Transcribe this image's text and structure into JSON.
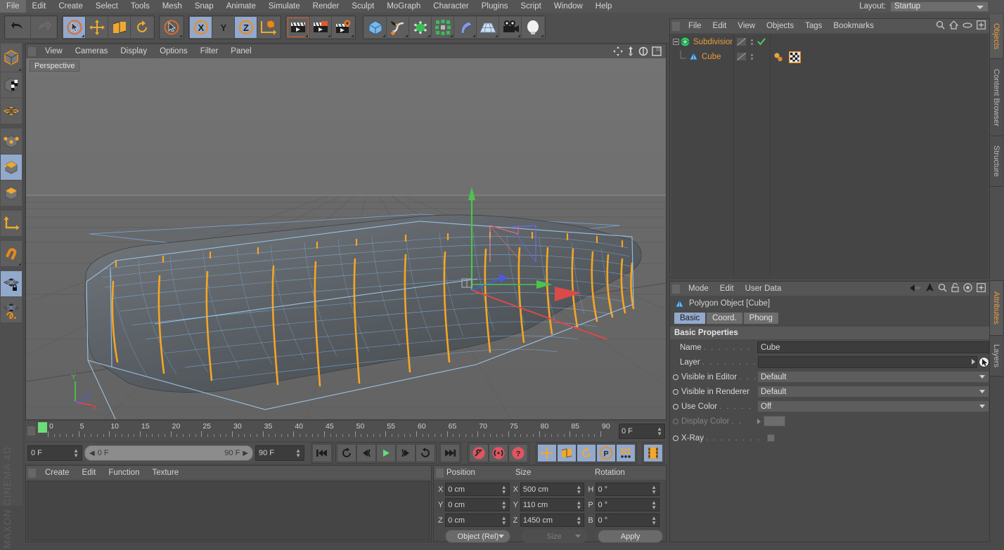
{
  "app": {
    "title": "MAXON CINEMA 4D",
    "brand_line1": "MAXON",
    "brand_line2": "CINEMA 4D"
  },
  "main_menu": [
    "File",
    "Edit",
    "Create",
    "Select",
    "Tools",
    "Mesh",
    "Snap",
    "Animate",
    "Simulate",
    "Render",
    "Sculpt",
    "MoGraph",
    "Character",
    "Plugins",
    "Script",
    "Window",
    "Help"
  ],
  "layout": {
    "label": "Layout:",
    "value": "Startup"
  },
  "toolbar": {
    "undo": "undo-icon",
    "redo": "redo-icon",
    "groups": [
      {
        "items": [
          {
            "icon": "live-selection-icon",
            "selected": true
          },
          {
            "icon": "move-icon",
            "selected": false
          },
          {
            "icon": "scale-icon",
            "selected": false
          },
          {
            "icon": "rotate-icon",
            "selected": false
          }
        ]
      },
      {
        "items": [
          {
            "icon": "selection-tool-icon",
            "selected": false
          }
        ]
      },
      {
        "items": [
          {
            "icon": "axis-x-icon",
            "selected": true
          },
          {
            "icon": "axis-y-icon",
            "selected": false
          },
          {
            "icon": "axis-z-icon",
            "selected": true
          },
          {
            "icon": "world-object-axis-icon",
            "selected": false
          }
        ]
      },
      {
        "items": [
          {
            "icon": "render-view-icon",
            "selected": false
          },
          {
            "icon": "render-region-icon",
            "selected": false
          },
          {
            "icon": "render-settings-icon",
            "selected": false
          }
        ]
      },
      {
        "items": [
          {
            "icon": "cube-primitive-icon",
            "selected": false
          },
          {
            "icon": "spline-pen-icon",
            "selected": false
          },
          {
            "icon": "generator-nurbs-icon",
            "selected": false
          },
          {
            "icon": "mograph-array-icon",
            "selected": false
          },
          {
            "icon": "deformer-bend-icon",
            "selected": false
          },
          {
            "icon": "scene-floor-icon",
            "selected": false
          },
          {
            "icon": "camera-icon",
            "selected": false
          },
          {
            "icon": "light-icon",
            "selected": false
          }
        ]
      }
    ]
  },
  "left_toolbar": [
    {
      "icon": "make-editable-icon",
      "selected": false
    },
    {
      "icon": "texture-axis-icon",
      "selected": false
    },
    {
      "icon": "viewport-solo-icon",
      "selected": false
    },
    {
      "icon": "point-mode-icon",
      "selected": false
    },
    {
      "icon": "edge-mode-icon",
      "selected": true
    },
    {
      "icon": "polygon-mode-icon",
      "selected": false
    },
    {
      "icon": "object-axis-icon",
      "selected": false
    },
    {
      "icon": "enable-snapping-icon",
      "selected": false
    },
    {
      "icon": "lock-workplane-icon",
      "selected": true
    },
    {
      "icon": "workplane-icon",
      "selected": false
    }
  ],
  "viewport": {
    "menu": [
      "View",
      "Cameras",
      "Display",
      "Options",
      "Filter",
      "Panel"
    ],
    "label": "Perspective",
    "corner_icons": [
      "pan-view-icon",
      "dolly-view-icon",
      "rotate-view-icon",
      "maximize-view-icon"
    ],
    "axis_gizmo": {
      "x": "X",
      "y": "Y",
      "z": "Z"
    }
  },
  "timeline": {
    "ticks": [
      0,
      5,
      10,
      15,
      20,
      25,
      30,
      35,
      40,
      45,
      50,
      55,
      60,
      65,
      70,
      75,
      80,
      85,
      90
    ],
    "current_frame": "0 F",
    "min_frame": "0 F",
    "max_frame": "90 F",
    "preview_start": "0 F",
    "preview_end": "90 F"
  },
  "transport": {
    "buttons": [
      {
        "icon": "go-to-start-icon",
        "selected": false
      },
      {
        "icon": "prev-keyframe-icon",
        "selected": false
      },
      {
        "icon": "step-back-icon",
        "selected": false
      },
      {
        "icon": "play-icon",
        "selected": false
      },
      {
        "icon": "step-forward-icon",
        "selected": false
      },
      {
        "icon": "next-keyframe-icon",
        "selected": false
      },
      {
        "icon": "go-to-end-icon",
        "selected": false
      },
      {
        "icon": "record-keyframe-icon",
        "selected": false
      },
      {
        "icon": "autokey-icon",
        "selected": false
      },
      {
        "icon": "keyframe-selection-icon",
        "selected": false
      },
      {
        "icon": "position-key-icon",
        "selected": true
      },
      {
        "icon": "scale-key-icon",
        "selected": true
      },
      {
        "icon": "rotation-key-icon",
        "selected": true
      },
      {
        "icon": "parameter-key-icon",
        "selected": true
      },
      {
        "icon": "point-level-anim-icon",
        "selected": true
      },
      {
        "icon": "timeline-icon",
        "selected": true
      }
    ]
  },
  "material_manager": {
    "menu": [
      "Create",
      "Edit",
      "Function",
      "Texture"
    ]
  },
  "coordinates": {
    "headers": [
      "Position",
      "Size",
      "Rotation"
    ],
    "rows": [
      {
        "pos_axis": "X",
        "pos_value": "0 cm",
        "size_axis": "X",
        "size_value": "500 cm",
        "rot_axis": "H",
        "rot_value": "0 °"
      },
      {
        "pos_axis": "Y",
        "pos_value": "0 cm",
        "size_axis": "Y",
        "size_value": "110 cm",
        "rot_axis": "P",
        "rot_value": "0 °"
      },
      {
        "pos_axis": "Z",
        "pos_value": "0 cm",
        "size_axis": "Z",
        "size_value": "1450 cm",
        "rot_axis": "B",
        "rot_value": "0 °"
      }
    ],
    "mode_dropdown": "Object (Rel)",
    "size_dropdown": "Size",
    "apply_button": "Apply"
  },
  "object_manager": {
    "menu": [
      "File",
      "Edit",
      "View",
      "Objects",
      "Tags",
      "Bookmarks"
    ],
    "icons": [
      "search-icon",
      "home-icon",
      "eye-icon",
      "add-layer-icon"
    ],
    "rows": [
      {
        "name": "Subdivision",
        "icon": "subdivision-surface-icon",
        "indent": 0,
        "expanded": true,
        "visible_check": true
      },
      {
        "name": "Cube",
        "icon": "polygon-object-icon",
        "indent": 1,
        "tags": [
          "phong-tag-icon",
          "checker-texture-tag-icon"
        ]
      }
    ]
  },
  "attributes": {
    "menu": [
      "Mode",
      "Edit",
      "User Data"
    ],
    "icons": [
      "back-icon",
      "pin-icon",
      "up-icon",
      "search-icon",
      "lock-icon",
      "target-icon",
      "add-icon"
    ],
    "object_title": "Polygon Object [Cube]",
    "tabs": [
      {
        "label": "Basic",
        "selected": true
      },
      {
        "label": "Coord.",
        "selected": false
      },
      {
        "label": "Phong",
        "selected": false
      }
    ],
    "section": "Basic Properties",
    "properties": [
      {
        "label": "Name",
        "dots": ". . . . . . . . . . . .",
        "type": "text",
        "value": "Cube",
        "enabled": true,
        "bullet": false
      },
      {
        "label": "Layer",
        "dots": ". . . . . . . . . . . .",
        "type": "layer",
        "value": "",
        "enabled": true,
        "bullet": false
      },
      {
        "label": "Visible in Editor",
        "dots": ". . .",
        "type": "dropdown",
        "value": "Default",
        "enabled": true,
        "bullet": true
      },
      {
        "label": "Visible in Renderer",
        "dots": "",
        "type": "dropdown",
        "value": "Default",
        "enabled": true,
        "bullet": true
      },
      {
        "label": "Use Color",
        "dots": ". . . . . . . .",
        "type": "dropdown",
        "value": "Off",
        "enabled": true,
        "bullet": true
      },
      {
        "label": "Display Color",
        "dots": ". .",
        "type": "color",
        "value": "",
        "enabled": false,
        "bullet": true
      },
      {
        "label": "X-Ray",
        "dots": ". . . . . . . . . . . .",
        "type": "checkbox",
        "value": "",
        "enabled": true,
        "bullet": true
      }
    ]
  },
  "vertical_tabs_top": [
    {
      "label": "Objects",
      "selected": true
    },
    {
      "label": "Content Browser",
      "selected": false
    },
    {
      "label": "Structure",
      "selected": false
    }
  ],
  "vertical_tabs_bottom": [
    {
      "label": "Attributes",
      "selected": true
    },
    {
      "label": "Layers",
      "selected": false
    }
  ],
  "colors": {
    "accent_orange": "#e89d3c",
    "selection_blue": "#93a9cc",
    "panel_bg": "#4a4a4a",
    "menubar_bg": "#555555",
    "field_bg": "#3c3c3c",
    "viewport_sky": "#6e6e6e",
    "wire_blue": "#7aa8d8",
    "edge_orange": "#f5a623",
    "axis_x": "#d94a4a",
    "axis_y": "#4ac44a",
    "axis_z": "#4a5ad9"
  }
}
